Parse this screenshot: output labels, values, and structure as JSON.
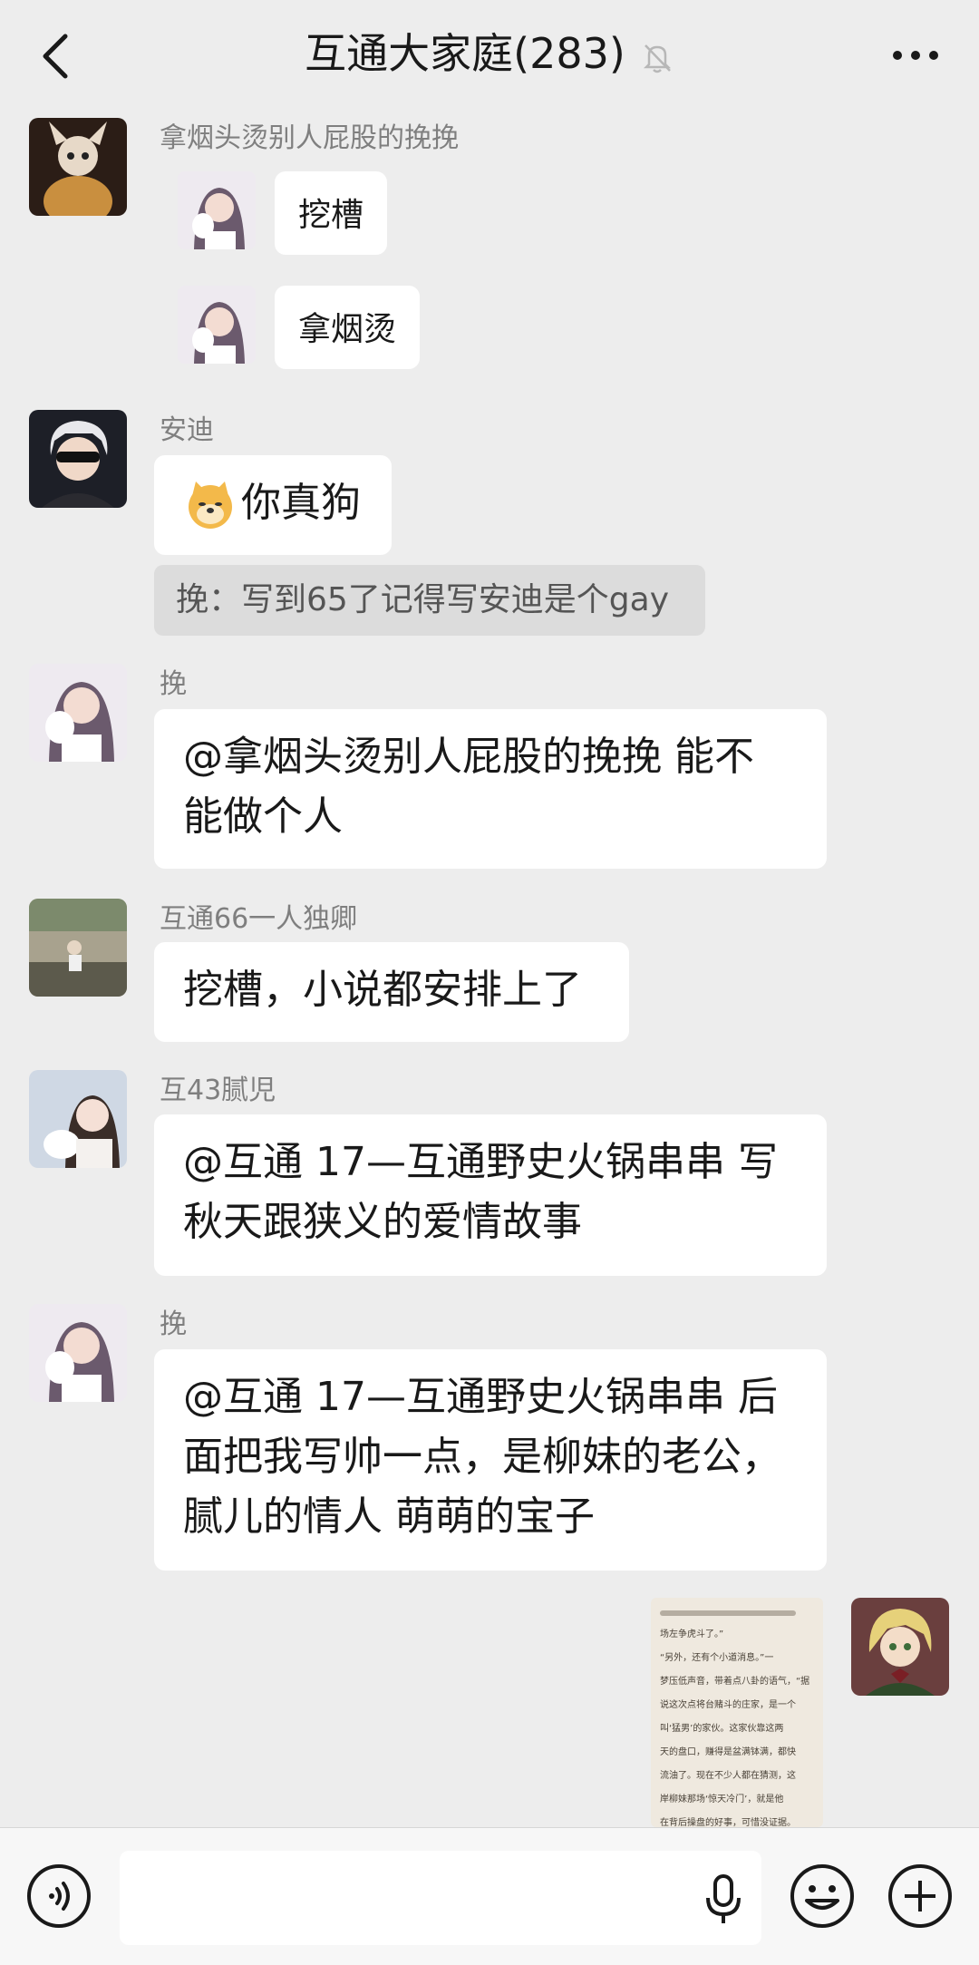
{
  "header": {
    "title": "互通大家庭(283)"
  },
  "messages": {
    "m1": {
      "sender": "拿烟头烫别人屁股的挽挽",
      "line1": "挖槽",
      "line2": "拿烟烫"
    },
    "m2": {
      "sender": "安迪",
      "text": "你真狗",
      "quote": "挽：写到65了记得写安迪是个gay"
    },
    "m3": {
      "sender": "挽",
      "line1": "@拿烟头烫别人屁股的挽挽  能不",
      "line2": "能做个人"
    },
    "m4": {
      "sender": "互通66一人独卿",
      "text": "挖槽，小说都安排上了"
    },
    "m5": {
      "sender": "互43腻児",
      "line1": "@互通 17—互通野史火锅串串  写",
      "line2": "秋天跟狭义的爱情故事"
    },
    "m6": {
      "sender": "挽",
      "line1": "@互通 17—互通野史火锅串串  后",
      "line2": "面把我写帅一点，是柳妹的老公，",
      "line3": "腻儿的情人  萌萌的宝子"
    },
    "m7": {
      "image_line1": "场左争虎斗了。”",
      "image_line2": "“另外，还有个小道消息。”一",
      "image_line3": "梦压低声音，带着点八卦的语气，“据",
      "image_line4": "说这次点将台赌斗的庄家，是一个",
      "image_line5": "叫‘猛男’的家伙。这家伙靠这两",
      "image_line6": "天的盘口，赚得是盆满钵满，都快",
      "image_line7": "流油了。现在不少人都在猜测，这",
      "image_line8": "岸柳妹那场‘惊天冷门’，就是他",
      "image_line9": "在背后操盘的好事，可惜没证据。"
    }
  },
  "icons": {
    "back": "chevron-left-icon",
    "mute": "bell-slash-icon",
    "more": "more-dots-icon",
    "voice": "voice-icon",
    "mic": "microphone-icon",
    "emoji": "smiley-icon",
    "plus": "plus-circle-icon"
  },
  "colors": {
    "background": "#ededed",
    "bubble": "#ffffff",
    "quote": "#dcdcdc",
    "sender": "#7f7f7f"
  }
}
